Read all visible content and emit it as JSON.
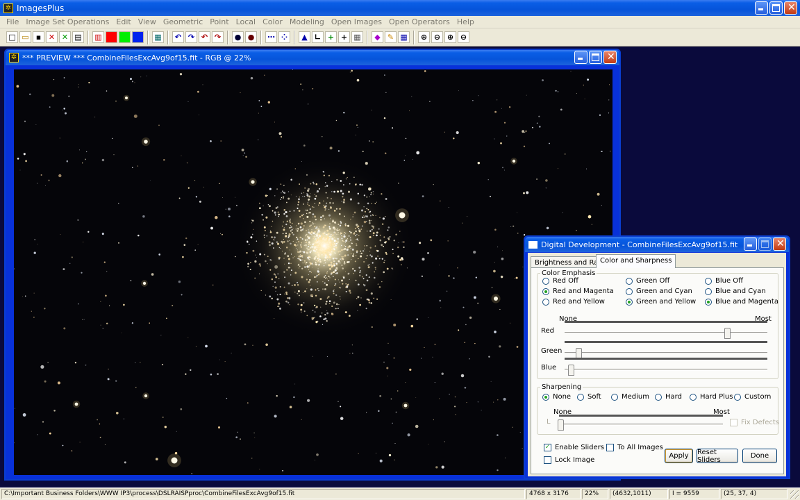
{
  "app": {
    "title": "ImagesPlus"
  },
  "menu": [
    "File",
    "Image Set Operations",
    "Edit",
    "View",
    "Geometric",
    "Point",
    "Local",
    "Color",
    "Modeling",
    "Open Images",
    "Open Operators",
    "Help"
  ],
  "toolbar_icons": [
    "new-icon",
    "open-icon",
    "save-icon",
    "close-red-icon",
    "close-green-icon",
    "print-icon",
    "rgb-channels-icon",
    "red-channel-icon",
    "green-channel-icon",
    "blue-channel-icon",
    "grid-icon",
    "undo-icon",
    "redo-icon",
    "undo-all-icon",
    "redo-all-icon",
    "circle-select-icon",
    "point-select-icon",
    "line-dots-icon",
    "line-plot-icon",
    "histogram-icon",
    "axis-icon",
    "crosshair-add-icon",
    "crosshair-icon",
    "calculator-icon",
    "paint-icon",
    "pencil-icon",
    "mosaic-icon",
    "zoom-in-icon",
    "zoom-out-icon",
    "zoom-fit-icon",
    "zoom-actual-icon"
  ],
  "preview": {
    "title": "*** PREVIEW *** CombineFilesExcAvg9of15.fit - RGB @ 22%"
  },
  "dialog": {
    "title": "Digital Development - CombineFilesExcAvg9of15.fit",
    "tabs": [
      "Brightness and Range",
      "Color and Sharpness"
    ],
    "active_tab": "Color and Sharpness",
    "color_emphasis": {
      "legend": "Color Emphasis",
      "columns": [
        {
          "options": [
            "Red Off",
            "Red and Magenta",
            "Red and Yellow"
          ],
          "selected": 1
        },
        {
          "options": [
            "Green Off",
            "Green and Cyan",
            "Green and Yellow"
          ],
          "selected": 2
        },
        {
          "options": [
            "Blue Off",
            "Blue and Cyan",
            "Blue and Magenta"
          ],
          "selected": 2
        }
      ],
      "scale_min": "None",
      "scale_max": "Most",
      "sliders": [
        {
          "label": "Red",
          "value": 0.8
        },
        {
          "label": "Green",
          "value": 0.07
        },
        {
          "label": "Blue",
          "value": 0.03
        }
      ]
    },
    "sharpening": {
      "legend": "Sharpening",
      "options": [
        "None",
        "Soft",
        "Medium",
        "Hard",
        "Hard Plus",
        "Custom"
      ],
      "selected": 0,
      "scale_min": "None",
      "scale_max": "Most",
      "slider_prefix": "L",
      "slider_value": 0.0,
      "fix_defects": "Fix Defects"
    },
    "enable_sliders": "Enable Sliders",
    "to_all_images": "To All Images",
    "lock_image": "Lock Image",
    "apply": "Apply",
    "reset": "Reset Sliders",
    "done": "Done"
  },
  "status": {
    "path": "C:\\Important Business Folders\\WWW IP3\\process\\DSLRAISPproc\\CombineFilesExcAvg9of15.fit",
    "dims": "4768 x 3176",
    "zoom": "22%",
    "coords": "(4632,1011)",
    "intensity": "I = 9559",
    "rgb": "(25, 37, 4)"
  }
}
